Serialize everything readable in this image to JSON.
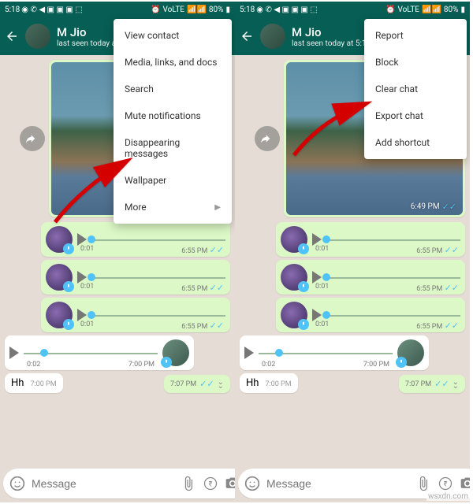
{
  "status": {
    "time": "5:18",
    "battery": "80%",
    "network": "VoLTE"
  },
  "header": {
    "contact_name": "M Jio",
    "last_seen": "last seen today at 5:16 PM"
  },
  "menu_left": {
    "view_contact": "View contact",
    "media": "Media, links, and docs",
    "search": "Search",
    "mute": "Mute notifications",
    "disappearing": "Disappearing messages",
    "wallpaper": "Wallpaper",
    "more": "More"
  },
  "menu_right": {
    "report": "Report",
    "block": "Block",
    "clear": "Clear chat",
    "export": "Export chat",
    "shortcut": "Add shortcut"
  },
  "messages": {
    "image_time": "6:49 PM",
    "voice1": {
      "duration": "0:01",
      "time": "6:55 PM"
    },
    "voice2": {
      "duration": "0:01",
      "time": "6:55 PM"
    },
    "voice3": {
      "duration": "0:01",
      "time": "6:55 PM"
    },
    "voice_in": {
      "duration": "0:02",
      "time": "7:00 PM"
    },
    "text_in": {
      "text": "Hh",
      "time": "7:00 PM"
    },
    "text_out_time": "7:07 PM"
  },
  "input": {
    "placeholder": "Message"
  },
  "watermark": "wsxdn.com"
}
